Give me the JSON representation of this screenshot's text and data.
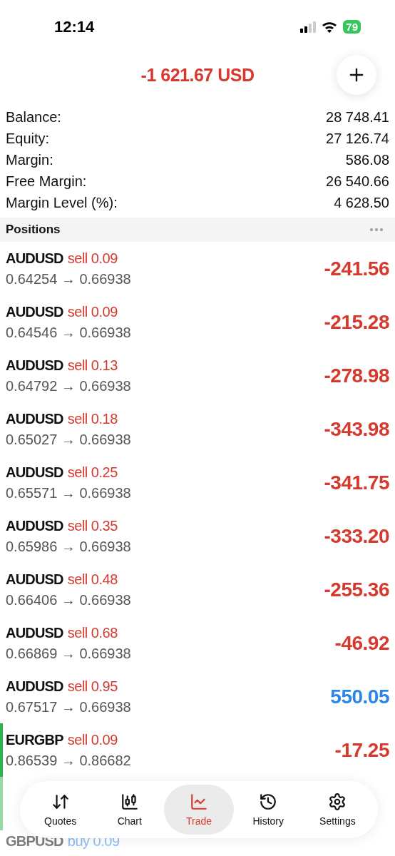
{
  "status_bar": {
    "time": "12:14",
    "battery": "79"
  },
  "header": {
    "total": "-1 621.67 USD"
  },
  "summary": [
    {
      "label": "Balance:",
      "value": "28 748.41"
    },
    {
      "label": "Equity:",
      "value": "27 126.74"
    },
    {
      "label": "Margin:",
      "value": "586.08"
    },
    {
      "label": "Free Margin:",
      "value": "26 540.66"
    },
    {
      "label": "Margin Level (%):",
      "value": "4 628.50"
    }
  ],
  "positions": {
    "title": "Positions",
    "rows": [
      {
        "symbol": "AUDUSD",
        "direction": "sell",
        "lots": "0.09",
        "prices": "0.64254 → 0.66938",
        "profit": "-241.56",
        "highlighted": false
      },
      {
        "symbol": "AUDUSD",
        "direction": "sell",
        "lots": "0.09",
        "prices": "0.64546 → 0.66938",
        "profit": "-215.28",
        "highlighted": false
      },
      {
        "symbol": "AUDUSD",
        "direction": "sell",
        "lots": "0.13",
        "prices": "0.64792 → 0.66938",
        "profit": "-278.98",
        "highlighted": false
      },
      {
        "symbol": "AUDUSD",
        "direction": "sell",
        "lots": "0.18",
        "prices": "0.65027 → 0.66938",
        "profit": "-343.98",
        "highlighted": false
      },
      {
        "symbol": "AUDUSD",
        "direction": "sell",
        "lots": "0.25",
        "prices": "0.65571 → 0.66938",
        "profit": "-341.75",
        "highlighted": false
      },
      {
        "symbol": "AUDUSD",
        "direction": "sell",
        "lots": "0.35",
        "prices": "0.65986 → 0.66938",
        "profit": "-333.20",
        "highlighted": false
      },
      {
        "symbol": "AUDUSD",
        "direction": "sell",
        "lots": "0.48",
        "prices": "0.66406 → 0.66938",
        "profit": "-255.36",
        "highlighted": false
      },
      {
        "symbol": "AUDUSD",
        "direction": "sell",
        "lots": "0.68",
        "prices": "0.66869 → 0.66938",
        "profit": "-46.92",
        "highlighted": false
      },
      {
        "symbol": "AUDUSD",
        "direction": "sell",
        "lots": "0.95",
        "prices": "0.67517 → 0.66938",
        "profit": "550.05",
        "highlighted": false
      },
      {
        "symbol": "EURGBP",
        "direction": "sell",
        "lots": "0.09",
        "prices": "0.86539 → 0.86682",
        "profit": "-17.25",
        "highlighted": true
      },
      {
        "symbol": "GBPUSD",
        "direction": "buy",
        "lots": "0.09",
        "highlighted": false
      }
    ]
  },
  "tab_bar": [
    {
      "label": "Quotes",
      "selected": false
    },
    {
      "label": "Chart",
      "selected": false
    },
    {
      "label": "Trade",
      "selected": true
    },
    {
      "label": "History",
      "selected": false
    },
    {
      "label": "Settings",
      "selected": false
    }
  ]
}
